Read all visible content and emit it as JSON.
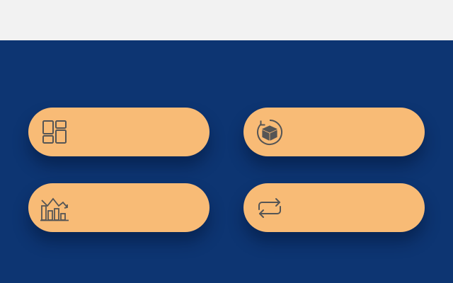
{
  "header": {
    "title": ""
  },
  "colors": {
    "header_bg": "#f2f2f2",
    "main_bg": "#0d3572",
    "tile_bg": "#f8bb76",
    "icon_stroke": "#555555"
  },
  "tiles": [
    {
      "icon": "dashboard-icon",
      "label": ""
    },
    {
      "icon": "package-return-icon",
      "label": ""
    },
    {
      "icon": "declining-chart-icon",
      "label": ""
    },
    {
      "icon": "repeat-arrows-icon",
      "label": ""
    }
  ]
}
